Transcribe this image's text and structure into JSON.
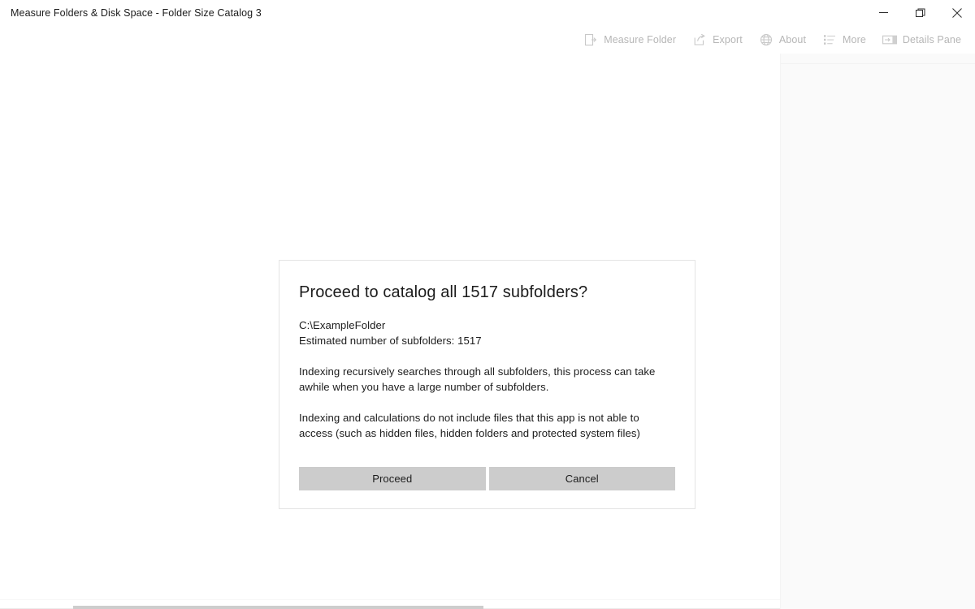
{
  "window": {
    "title": "Measure Folders & Disk Space - Folder Size Catalog 3",
    "controls": {
      "minimize": "minimize-button",
      "restore": "restore-button",
      "close": "close-button"
    }
  },
  "toolbar": {
    "items": [
      {
        "label": "Measure Folder",
        "icon": "measure-folder-icon"
      },
      {
        "label": "Export",
        "icon": "export-icon"
      },
      {
        "label": "About",
        "icon": "globe-icon"
      },
      {
        "label": "More",
        "icon": "list-icon"
      },
      {
        "label": "Details Pane",
        "icon": "details-pane-icon"
      }
    ]
  },
  "dialog": {
    "title": "Proceed to catalog all 1517 subfolders?",
    "folder_path": "C:\\ExampleFolder",
    "estimate_line": "Estimated number of subfolders: 1517",
    "paragraph_1": "Indexing recursively searches through all subfolders, this process can take awhile when you have a large number of subfolders.",
    "paragraph_2": "Indexing and calculations do not include files that this app is not able to access (such as hidden files, hidden folders and protected system files)",
    "proceed_label": "Proceed",
    "cancel_label": "Cancel"
  },
  "colors": {
    "window_background": "#ffffff",
    "toolbar_text": "#b6b6b6",
    "dialog_border": "#e4e4e4",
    "button_background": "#cccccc",
    "details_pane_background": "#fafafa",
    "text_primary": "#1c1c1c"
  }
}
